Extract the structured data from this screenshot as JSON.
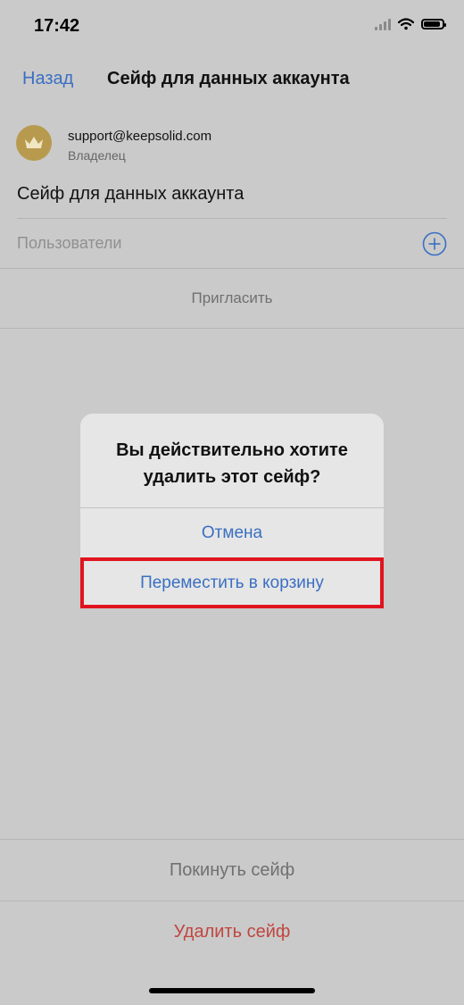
{
  "status_bar": {
    "time": "17:42"
  },
  "nav": {
    "back_label": "Назад",
    "title": "Сейф для данных аккаунта"
  },
  "owner": {
    "email": "support@keepsolid.com",
    "role": "Владелец"
  },
  "vault": {
    "name": "Сейф для данных аккаунта",
    "users_label": "Пользователи",
    "invite_label": "Пригласить"
  },
  "alert": {
    "title_line1": "Вы действительно хотите",
    "title_line2": "удалить этот сейф?",
    "cancel_label": "Отмена",
    "move_to_trash_label": "Переместить в корзину"
  },
  "bottom": {
    "leave_label": "Покинуть сейф",
    "delete_label": "Удалить сейф"
  },
  "colors": {
    "accent": "#3a6fc2",
    "destructive": "#c0463f",
    "highlight": "#e0141e",
    "avatar": "#b89a4f"
  },
  "icons": {
    "avatar": "crown-icon",
    "add_user": "plus-circle-icon",
    "signal": "cellular-signal-icon",
    "wifi": "wifi-icon",
    "battery": "battery-icon"
  }
}
